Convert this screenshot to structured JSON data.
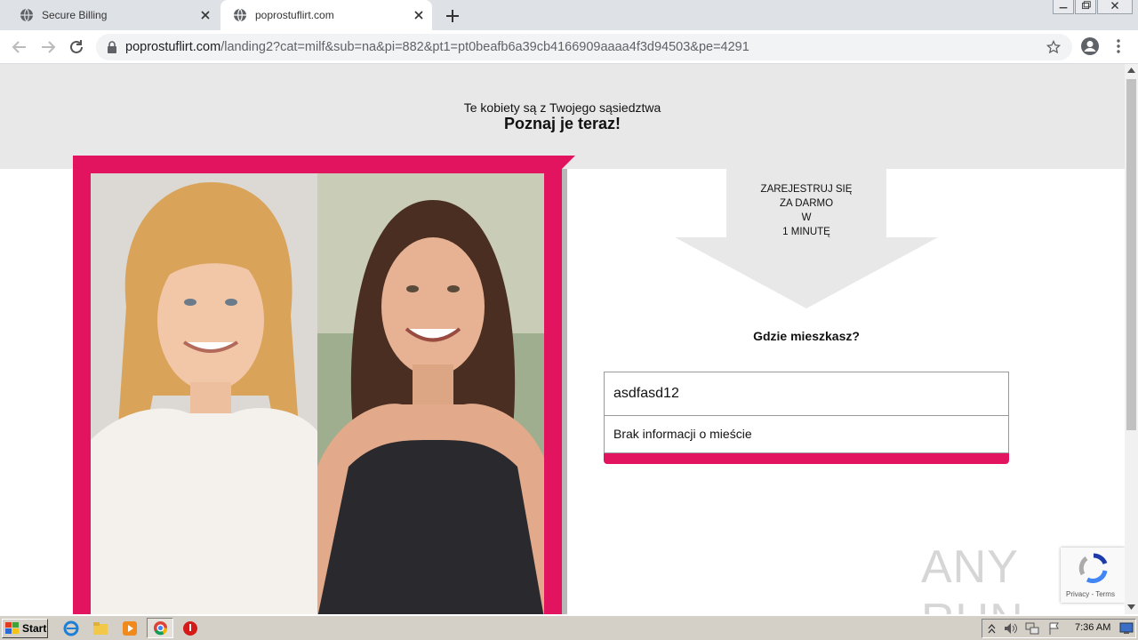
{
  "browser": {
    "tabs": [
      {
        "title": "Secure Billing",
        "icon": "globe-icon"
      },
      {
        "title": "poprostuflirt.com",
        "icon": "globe-icon"
      }
    ],
    "url_domain": "poprostuflirt.com",
    "url_path": "/landing2?cat=milf&sub=na&pi=882&pt1=pt0beafb6a39cb4166909aaaa4f3d94503&pe=4291"
  },
  "hero": {
    "subtitle": "Te kobiety są z Twojego sąsiedztwa",
    "title": "Poznaj je teraz!"
  },
  "signup": {
    "arrow_text": "ZAREJESTRUJ SIĘ\nZA DARMO\nW\n1 MINUTĘ",
    "question": "Gdzie mieszkasz?",
    "city_input_value": "asdfasd12",
    "city_message": "Brak informacji o mieście"
  },
  "watermark": "ANY RUN",
  "recaptcha": {
    "links": "Privacy - Terms"
  },
  "taskbar": {
    "start_label": "Start",
    "clock": "7:36 AM"
  },
  "colors": {
    "accent": "#e3145f",
    "panel": "#e8e8e8"
  }
}
